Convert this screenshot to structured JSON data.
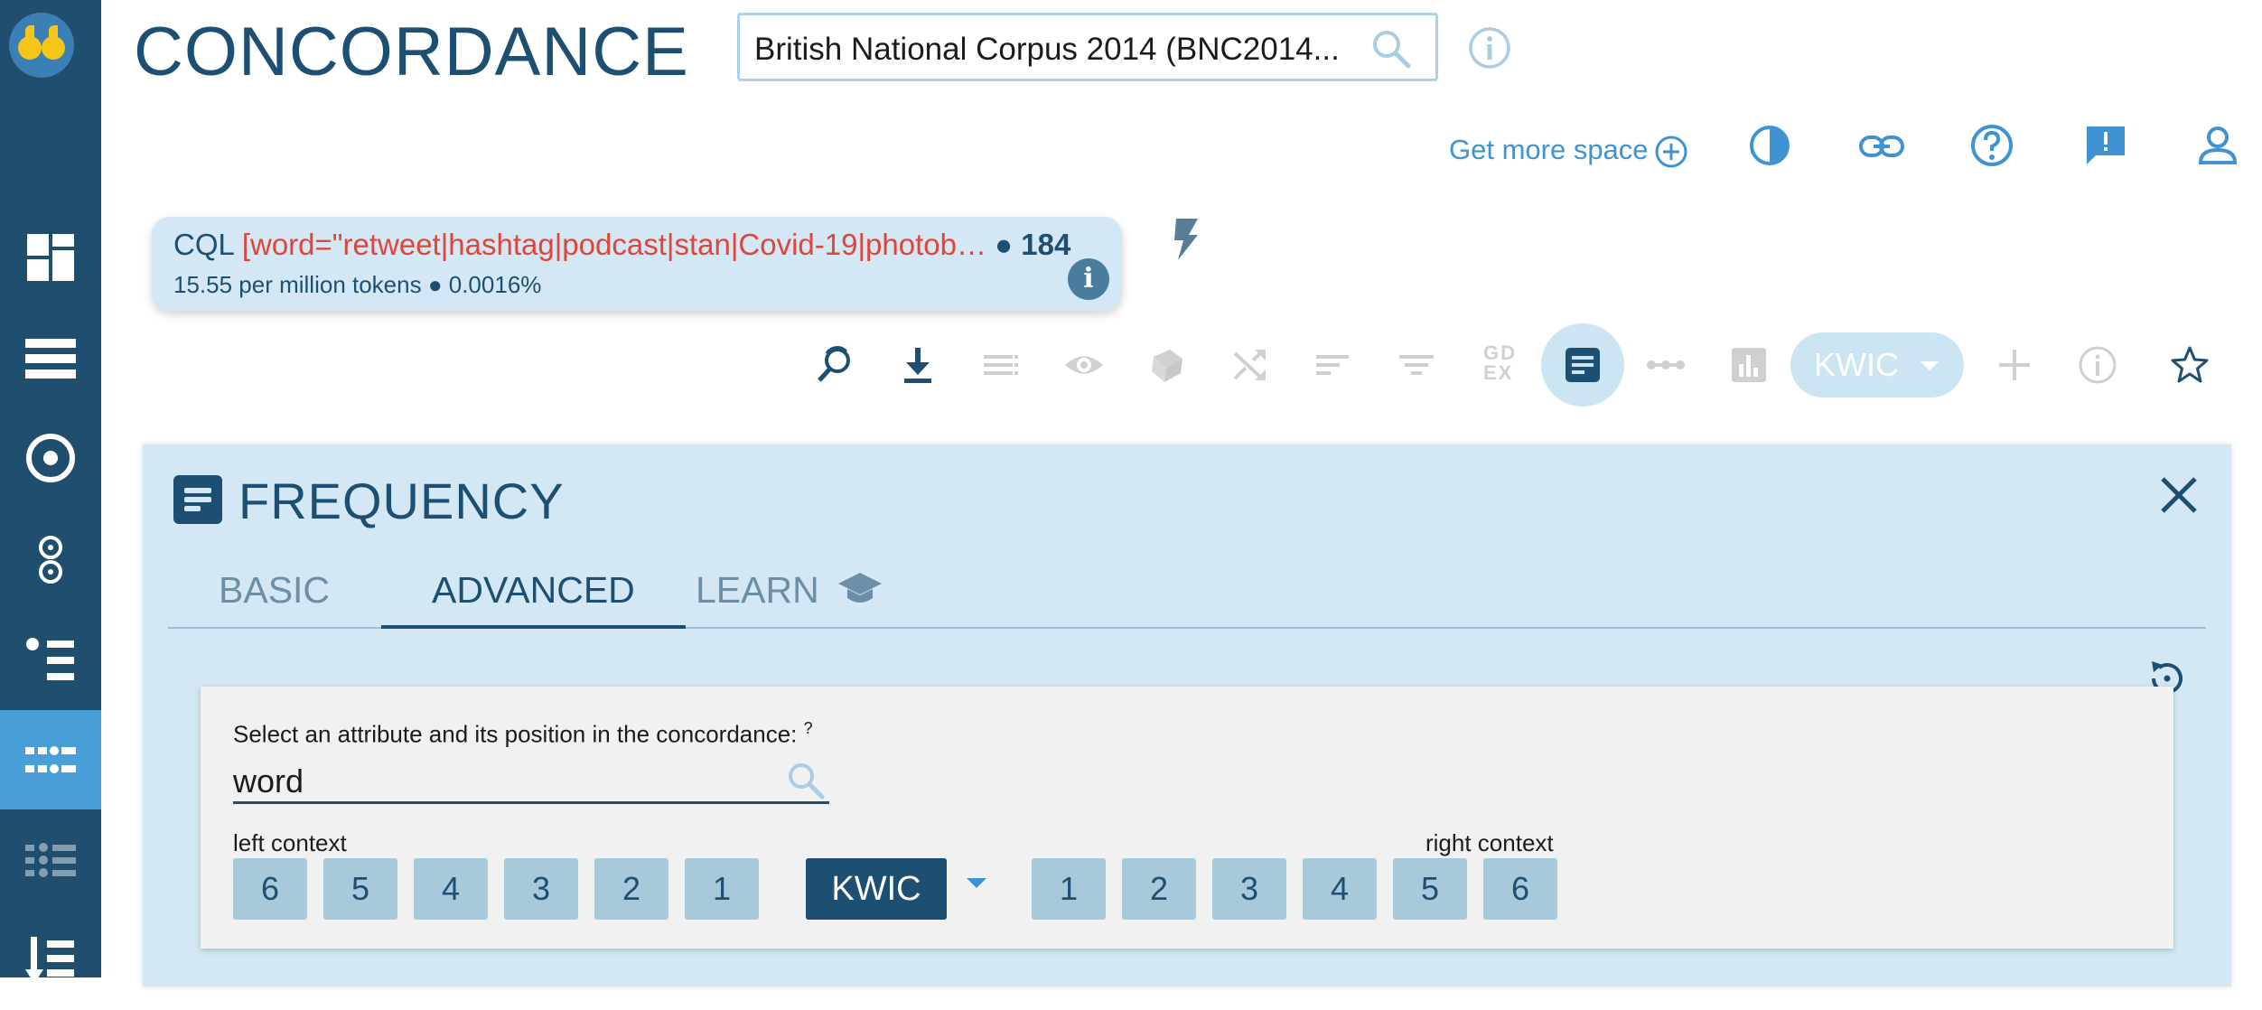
{
  "app": {
    "title": "CONCORDANCE"
  },
  "corpus": {
    "selected": "British National Corpus 2014 (BNC2014..."
  },
  "header_links": {
    "get_more_space": "Get more space"
  },
  "sidebar": {
    "items": [
      {
        "name": "dashboard",
        "icon": "dashboard-icon"
      },
      {
        "name": "list",
        "icon": "list-icon"
      },
      {
        "name": "target",
        "icon": "target-icon"
      },
      {
        "name": "two-dots",
        "icon": "two-circles-icon"
      },
      {
        "name": "wordlist",
        "icon": "bullet-list-icon"
      },
      {
        "name": "concordance",
        "icon": "concordance-icon",
        "active": true
      },
      {
        "name": "parallel",
        "icon": "parallel-icon"
      },
      {
        "name": "sort",
        "icon": "sort-down-icon"
      }
    ]
  },
  "query": {
    "type_label": "CQL",
    "cql": "[word=\"retweet|hashtag|podcast|stan|Covid-19|photob…",
    "bullet": "●",
    "hits": "184",
    "stats": "15.55 per million tokens ● 0.0016%"
  },
  "toolbar": {
    "gdex_line1": "GD",
    "gdex_line2": "EX",
    "view_mode": "KWIC"
  },
  "frequency": {
    "title": "FREQUENCY",
    "tabs": [
      "BASIC",
      "ADVANCED",
      "LEARN"
    ],
    "active_tab": "ADVANCED",
    "attribute_label": "Select an attribute and its position in the concordance:",
    "help_mark": "?",
    "attribute_value": "word",
    "left_context_label": "left context",
    "right_context_label": "right context",
    "left_positions": [
      "6",
      "5",
      "4",
      "3",
      "2",
      "1"
    ],
    "kwic_label": "KWIC",
    "right_positions": [
      "1",
      "2",
      "3",
      "4",
      "5",
      "6"
    ]
  },
  "colors": {
    "sidebar_bg": "#1f4e6f",
    "sidebar_active": "#4a9fd8",
    "primary": "#1d4f73",
    "accent": "#3f93d2",
    "query_red": "#e0453a",
    "panel_bg": "#d3e8f4"
  }
}
